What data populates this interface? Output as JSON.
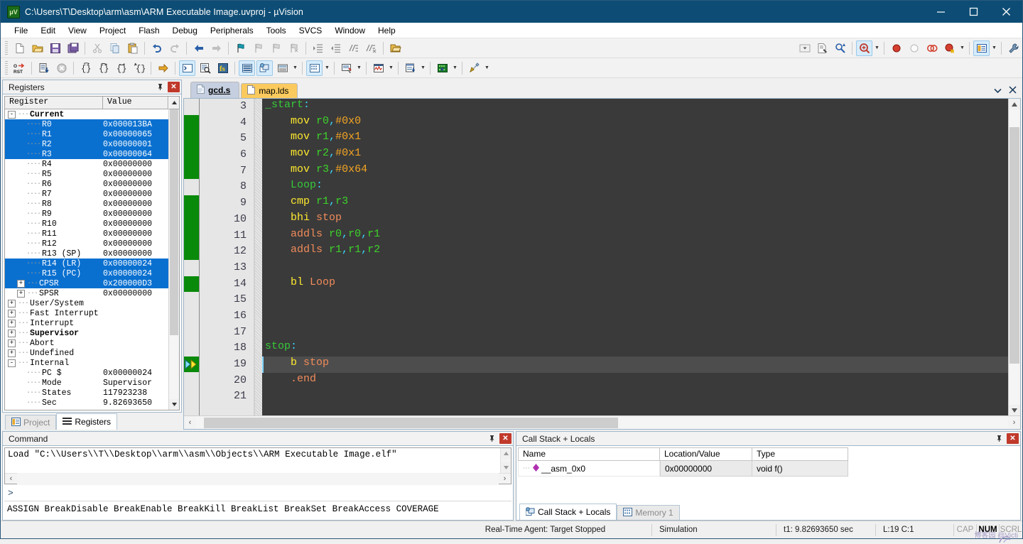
{
  "window": {
    "title": "C:\\Users\\T\\Desktop\\arm\\asm\\ARM Executable Image.uvproj - µVision",
    "logo_text": "μV",
    "minimize": "–",
    "maximize": "□",
    "close": "✕"
  },
  "menubar": {
    "items": [
      "File",
      "Edit",
      "View",
      "Project",
      "Flash",
      "Debug",
      "Peripherals",
      "Tools",
      "SVCS",
      "Window",
      "Help"
    ]
  },
  "toolbar_file": {
    "icons": [
      "new-file-icon",
      "open-file-icon",
      "save-icon",
      "save-all-icon",
      "cut-icon",
      "copy-icon",
      "paste-icon",
      "undo-icon",
      "redo-icon",
      "navigate-back-icon",
      "navigate-forward-icon",
      "bookmark-toggle-icon",
      "bookmark-prev-icon",
      "bookmark-next-icon",
      "bookmark-clear-icon",
      "indent-icon",
      "outdent-icon",
      "comment-icon",
      "uncomment-icon",
      "open-folder-icon",
      "combo-dropdown-icon",
      "find-in-files-icon",
      "incremental-find-icon",
      "debug-session-icon",
      "insert-breakpoint-icon",
      "disable-breakpoint-icon",
      "kill-all-breakpoints-icon",
      "disable-all-breakpoints-icon",
      "manage-windows-icon",
      "configure-icon"
    ]
  },
  "toolbar_debug": {
    "icons": [
      "reset-cpu-icon",
      "run-icon",
      "stop-icon",
      "step-into-icon",
      "step-over-icon",
      "step-out-icon",
      "run-to-cursor-icon",
      "show-next-statement-icon",
      "command-window-icon",
      "disassembly-window-icon",
      "symbols-window-icon",
      "registers-window-icon",
      "call-stack-window-icon",
      "watch-windows-icon",
      "memory-windows-icon",
      "serial-windows-icon",
      "analysis-windows-icon",
      "trace-windows-icon",
      "system-viewer-icon",
      "toolbox-icon"
    ]
  },
  "left_panel": {
    "caption": "Registers",
    "pin_icon": "pin-icon",
    "close_icon": "close-icon",
    "columns": [
      "Register",
      "Value"
    ],
    "rows": [
      {
        "label": "Current",
        "value": "",
        "indent": 0,
        "twisty": "-",
        "bold": true,
        "selected": false
      },
      {
        "label": "R0",
        "value": "0x000013BA",
        "indent": 2,
        "twisty": "",
        "bold": false,
        "selected": true
      },
      {
        "label": "R1",
        "value": "0x00000065",
        "indent": 2,
        "twisty": "",
        "bold": false,
        "selected": true
      },
      {
        "label": "R2",
        "value": "0x00000001",
        "indent": 2,
        "twisty": "",
        "bold": false,
        "selected": true
      },
      {
        "label": "R3",
        "value": "0x00000064",
        "indent": 2,
        "twisty": "",
        "bold": false,
        "selected": true
      },
      {
        "label": "R4",
        "value": "0x00000000",
        "indent": 2,
        "twisty": "",
        "bold": false,
        "selected": false
      },
      {
        "label": "R5",
        "value": "0x00000000",
        "indent": 2,
        "twisty": "",
        "bold": false,
        "selected": false
      },
      {
        "label": "R6",
        "value": "0x00000000",
        "indent": 2,
        "twisty": "",
        "bold": false,
        "selected": false
      },
      {
        "label": "R7",
        "value": "0x00000000",
        "indent": 2,
        "twisty": "",
        "bold": false,
        "selected": false
      },
      {
        "label": "R8",
        "value": "0x00000000",
        "indent": 2,
        "twisty": "",
        "bold": false,
        "selected": false
      },
      {
        "label": "R9",
        "value": "0x00000000",
        "indent": 2,
        "twisty": "",
        "bold": false,
        "selected": false
      },
      {
        "label": "R10",
        "value": "0x00000000",
        "indent": 2,
        "twisty": "",
        "bold": false,
        "selected": false
      },
      {
        "label": "R11",
        "value": "0x00000000",
        "indent": 2,
        "twisty": "",
        "bold": false,
        "selected": false
      },
      {
        "label": "R12",
        "value": "0x00000000",
        "indent": 2,
        "twisty": "",
        "bold": false,
        "selected": false
      },
      {
        "label": "R13 (SP)",
        "value": "0x00000000",
        "indent": 2,
        "twisty": "",
        "bold": false,
        "selected": false
      },
      {
        "label": "R14 (LR)",
        "value": "0x00000024",
        "indent": 2,
        "twisty": "",
        "bold": false,
        "selected": true
      },
      {
        "label": "R15 (PC)",
        "value": "0x00000024",
        "indent": 2,
        "twisty": "",
        "bold": false,
        "selected": true
      },
      {
        "label": "CPSR",
        "value": "0x200000D3",
        "indent": 1,
        "twisty": "+",
        "bold": false,
        "selected": true
      },
      {
        "label": "SPSR",
        "value": "0x00000000",
        "indent": 1,
        "twisty": "+",
        "bold": false,
        "selected": false
      },
      {
        "label": "User/System",
        "value": "",
        "indent": 0,
        "twisty": "+",
        "bold": false,
        "selected": false
      },
      {
        "label": "Fast Interrupt",
        "value": "",
        "indent": 0,
        "twisty": "+",
        "bold": false,
        "selected": false
      },
      {
        "label": "Interrupt",
        "value": "",
        "indent": 0,
        "twisty": "+",
        "bold": false,
        "selected": false
      },
      {
        "label": "Supervisor",
        "value": "",
        "indent": 0,
        "twisty": "+",
        "bold": true,
        "selected": false
      },
      {
        "label": "Abort",
        "value": "",
        "indent": 0,
        "twisty": "+",
        "bold": false,
        "selected": false
      },
      {
        "label": "Undefined",
        "value": "",
        "indent": 0,
        "twisty": "+",
        "bold": false,
        "selected": false
      },
      {
        "label": "Internal",
        "value": "",
        "indent": 0,
        "twisty": "-",
        "bold": false,
        "selected": false
      },
      {
        "label": "PC $",
        "value": "0x00000024",
        "indent": 2,
        "twisty": "",
        "bold": false,
        "selected": false
      },
      {
        "label": "Mode",
        "value": "Supervisor",
        "indent": 2,
        "twisty": "",
        "bold": false,
        "selected": false
      },
      {
        "label": "States",
        "value": "117923238",
        "indent": 2,
        "twisty": "",
        "bold": false,
        "selected": false
      },
      {
        "label": "Sec",
        "value": "9.82693650",
        "indent": 2,
        "twisty": "",
        "bold": false,
        "selected": false
      }
    ],
    "tabs": [
      {
        "label": "Project",
        "icon": "project-icon",
        "active": false
      },
      {
        "label": "Registers",
        "icon": "registers-icon",
        "active": true
      }
    ]
  },
  "editor": {
    "tabs": [
      {
        "label": "gcd.s",
        "icon": "source-file-icon",
        "active": true
      },
      {
        "label": "map.lds",
        "icon": "linker-file-icon",
        "active": false
      }
    ],
    "tab_menu_icon": "chevron-down-icon",
    "tab_close_icon": "close-icon",
    "first_line_number": 3,
    "current_line": 19,
    "lines": [
      {
        "n": 3,
        "tokens": [
          {
            "t": "_start",
            "c": "lbl"
          },
          {
            "t": ":",
            "c": "col"
          }
        ],
        "cov": false
      },
      {
        "n": 4,
        "tokens": [
          {
            "t": "    ",
            "c": "plain"
          },
          {
            "t": "mov ",
            "c": "mn"
          },
          {
            "t": "r0",
            "c": "reg"
          },
          {
            "t": ",",
            "c": "col"
          },
          {
            "t": "#0x0",
            "c": "imm"
          }
        ],
        "cov": true
      },
      {
        "n": 5,
        "tokens": [
          {
            "t": "    ",
            "c": "plain"
          },
          {
            "t": "mov ",
            "c": "mn"
          },
          {
            "t": "r1",
            "c": "reg"
          },
          {
            "t": ",",
            "c": "col"
          },
          {
            "t": "#0x1",
            "c": "imm"
          }
        ],
        "cov": true
      },
      {
        "n": 6,
        "tokens": [
          {
            "t": "    ",
            "c": "plain"
          },
          {
            "t": "mov ",
            "c": "mn"
          },
          {
            "t": "r2",
            "c": "reg"
          },
          {
            "t": ",",
            "c": "col"
          },
          {
            "t": "#0x1",
            "c": "imm"
          }
        ],
        "cov": true
      },
      {
        "n": 7,
        "tokens": [
          {
            "t": "    ",
            "c": "plain"
          },
          {
            "t": "mov ",
            "c": "mn"
          },
          {
            "t": "r3",
            "c": "reg"
          },
          {
            "t": ",",
            "c": "col"
          },
          {
            "t": "#0x64",
            "c": "imm"
          }
        ],
        "cov": true
      },
      {
        "n": 8,
        "tokens": [
          {
            "t": "    ",
            "c": "plain"
          },
          {
            "t": "Loop",
            "c": "lbl"
          },
          {
            "t": ":",
            "c": "col"
          }
        ],
        "cov": false
      },
      {
        "n": 9,
        "tokens": [
          {
            "t": "    ",
            "c": "plain"
          },
          {
            "t": "cmp ",
            "c": "mn"
          },
          {
            "t": "r1",
            "c": "reg"
          },
          {
            "t": ",",
            "c": "col"
          },
          {
            "t": "r3",
            "c": "reg"
          }
        ],
        "cov": true
      },
      {
        "n": 10,
        "tokens": [
          {
            "t": "    ",
            "c": "plain"
          },
          {
            "t": "bhi ",
            "c": "mn"
          },
          {
            "t": "stop",
            "c": "br"
          }
        ],
        "cov": true
      },
      {
        "n": 11,
        "tokens": [
          {
            "t": "    ",
            "c": "plain"
          },
          {
            "t": "addls ",
            "c": "br"
          },
          {
            "t": "r0",
            "c": "reg"
          },
          {
            "t": ",",
            "c": "col"
          },
          {
            "t": "r0",
            "c": "reg"
          },
          {
            "t": ",",
            "c": "col"
          },
          {
            "t": "r1",
            "c": "reg"
          }
        ],
        "cov": true
      },
      {
        "n": 12,
        "tokens": [
          {
            "t": "    ",
            "c": "plain"
          },
          {
            "t": "addls ",
            "c": "br"
          },
          {
            "t": "r1",
            "c": "reg"
          },
          {
            "t": ",",
            "c": "col"
          },
          {
            "t": "r1",
            "c": "reg"
          },
          {
            "t": ",",
            "c": "col"
          },
          {
            "t": "r2",
            "c": "reg"
          }
        ],
        "cov": true
      },
      {
        "n": 13,
        "tokens": [],
        "cov": false
      },
      {
        "n": 14,
        "tokens": [
          {
            "t": "    ",
            "c": "plain"
          },
          {
            "t": "bl ",
            "c": "mn"
          },
          {
            "t": "Loop",
            "c": "br"
          }
        ],
        "cov": true
      },
      {
        "n": 15,
        "tokens": [],
        "cov": false
      },
      {
        "n": 16,
        "tokens": [],
        "cov": false
      },
      {
        "n": 17,
        "tokens": [],
        "cov": false
      },
      {
        "n": 18,
        "tokens": [
          {
            "t": "stop",
            "c": "lbl"
          },
          {
            "t": ":",
            "c": "col"
          }
        ],
        "cov": false
      },
      {
        "n": 19,
        "tokens": [
          {
            "t": "    ",
            "c": "plain"
          },
          {
            "t": "b ",
            "c": "mn"
          },
          {
            "t": "stop",
            "c": "br"
          }
        ],
        "cov": false
      },
      {
        "n": 20,
        "tokens": [
          {
            "t": "    ",
            "c": "plain"
          },
          {
            "t": ".end",
            "c": "dir"
          }
        ],
        "cov": false
      },
      {
        "n": 21,
        "tokens": [],
        "cov": false
      }
    ]
  },
  "command_panel": {
    "caption": "Command",
    "pin_icon": "pin-icon",
    "close_icon": "close-icon",
    "output": "Load \"C:\\\\Users\\\\T\\\\Desktop\\\\arm\\\\asm\\\\Objects\\\\ARM Executable Image.elf\"",
    "prompt": ">",
    "input_value": "",
    "hints": "ASSIGN BreakDisable BreakEnable BreakKill BreakList BreakSet BreakAccess COVERAGE"
  },
  "callstack_panel": {
    "caption": "Call Stack + Locals",
    "pin_icon": "pin-icon",
    "close_icon": "close-icon",
    "columns": [
      "Name",
      "Location/Value",
      "Type"
    ],
    "rows": [
      {
        "name": "__asm_0x0",
        "location": "0x00000000",
        "type": "void f()",
        "icon": "function-marker-icon"
      }
    ],
    "tabs": [
      {
        "label": "Call Stack + Locals",
        "icon": "call-stack-icon",
        "active": true
      },
      {
        "label": "Memory 1",
        "icon": "memory-icon",
        "active": false
      }
    ]
  },
  "statusbar": {
    "agent": "Real-Time Agent: Target Stopped",
    "target": "Simulation",
    "time": "t1: 9.82693650 sec",
    "position": "L:19 C:1",
    "cap": "CAP",
    "num": "NUM",
    "scrl": "SCRL",
    "watermark": "博客园 @Victi"
  },
  "colors": {
    "titlebar": "#0d4d75",
    "accent_blue": "#0a70d0",
    "editor_bg": "#3a3a3a",
    "coverage_green": "#0a8a0a",
    "tab_active": "#c5cfe0",
    "tab_inactive": "#fbca5e",
    "close_red": "#c0392b"
  }
}
